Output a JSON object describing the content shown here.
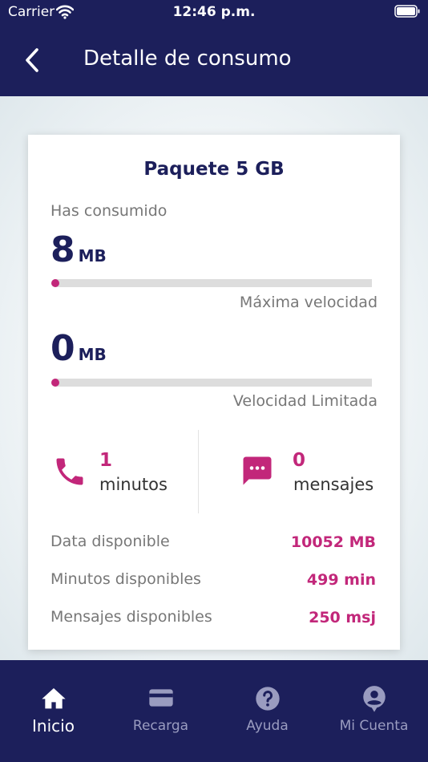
{
  "status_bar": {
    "carrier": "Carrier",
    "time": "12:46 p.m."
  },
  "header": {
    "title": "Detalle de consumo",
    "back_icon": "chevron-left-icon"
  },
  "card": {
    "title": "Paquete 5 GB",
    "consumed_label": "Has consumido",
    "usage": [
      {
        "value": "8",
        "unit": "MB",
        "caption": "Máxima velocidad",
        "progress": 0
      },
      {
        "value": "0",
        "unit": "MB",
        "caption": "Velocidad Limitada",
        "progress": 0
      }
    ],
    "stats": {
      "calls": {
        "icon": "phone-icon",
        "value": "1",
        "label": "minutos"
      },
      "messages": {
        "icon": "chat-bubble-icon",
        "value": "0",
        "label": "mensajes"
      }
    },
    "available": [
      {
        "label": "Data disponible",
        "value": "10052 MB"
      },
      {
        "label": "Minutos disponibles",
        "value": "499 min"
      },
      {
        "label": "Mensajes disponibles",
        "value": "250 msj"
      }
    ]
  },
  "tabbar": {
    "items": [
      {
        "label": "Inicio",
        "icon": "home-icon",
        "active": true
      },
      {
        "label": "Recarga",
        "icon": "credit-card-icon",
        "active": false
      },
      {
        "label": "Ayuda",
        "icon": "help-circle-icon",
        "active": false
      },
      {
        "label": "Mi Cuenta",
        "icon": "user-circle-icon",
        "active": false
      }
    ]
  },
  "colors": {
    "primary": "#1c1f5b",
    "accent": "#c2277a",
    "bar_track": "#dddddd"
  }
}
